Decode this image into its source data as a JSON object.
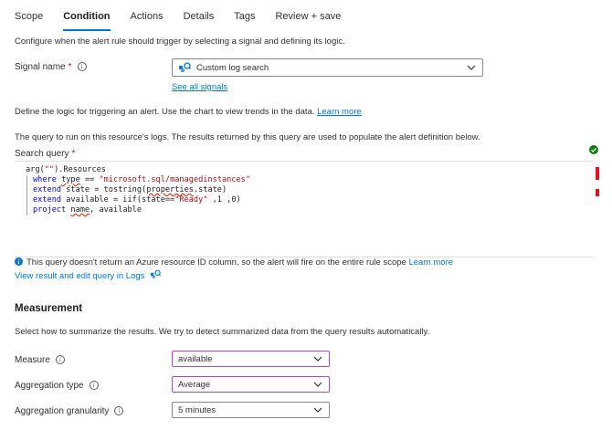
{
  "tabs": [
    "Scope",
    "Condition",
    "Actions",
    "Details",
    "Tags",
    "Review + save"
  ],
  "active_tab": "Condition",
  "intro": "Configure when the alert rule should trigger by selecting a signal and defining its logic.",
  "signal": {
    "label": "Signal name",
    "required_mark": "*",
    "value": "Custom log search",
    "see_all": "See all signals"
  },
  "logic_text": "Define the logic for triggering an alert. Use the chart to view trends in the data.",
  "learn_more": "Learn more",
  "query_desc": "The query to run on this resource's logs. The results returned by this query are used to populate the alert definition below.",
  "search_query_label": "Search query",
  "code": {
    "l1_a": "arg(",
    "l1_str": "\"\"",
    "l1_b": ").Resources",
    "l2_kw": "where",
    "l2_a": " ",
    "l2_sq": "type",
    "l2_b": " == ",
    "l2_str": "\"microsoft.sql/managedinstances\"",
    "l3_kw": "extend",
    "l3_a": " state = tostring(",
    "l3_sq": "properties",
    "l3_b": ".state)",
    "l4_kw": "extend",
    "l4_a": " available = iif(state==",
    "l4_str": "\"Ready\"",
    "l4_b": " ,1 ,0)",
    "l5_kw": "project",
    "l5_a": " ",
    "l5_sq": "name",
    "l5_b": ", available"
  },
  "warning": "This query doesn't return an Azure resource ID column, so the alert will fire on the entire rule scope",
  "view_logs": "View result and edit query in Logs",
  "measurement": {
    "title": "Measurement",
    "desc": "Select how to summarize the results. We try to detect summarized data from the query results automatically.",
    "measure_label": "Measure",
    "measure_value": "available",
    "agg_type_label": "Aggregation type",
    "agg_type_value": "Average",
    "agg_gran_label": "Aggregation granularity",
    "agg_gran_value": "5 minutes"
  },
  "colors": {
    "accent": "#0078d4",
    "purple_border": "#b146c2",
    "success": "#107c10",
    "error": "#e81123"
  }
}
